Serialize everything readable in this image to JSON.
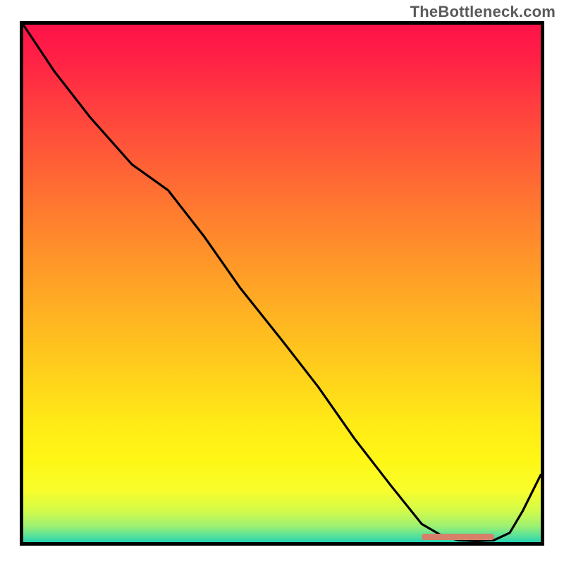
{
  "watermark": "TheBottleneck.com",
  "chart_data": {
    "type": "line",
    "title": "",
    "xlabel": "",
    "ylabel": "",
    "x": [
      0.0,
      0.06,
      0.13,
      0.21,
      0.28,
      0.35,
      0.42,
      0.5,
      0.57,
      0.64,
      0.71,
      0.77,
      0.81,
      0.84,
      0.875,
      0.91,
      0.94,
      0.965,
      1.0
    ],
    "values": [
      1.0,
      0.91,
      0.82,
      0.73,
      0.68,
      0.59,
      0.49,
      0.39,
      0.3,
      0.2,
      0.11,
      0.035,
      0.012,
      0.004,
      0.002,
      0.004,
      0.018,
      0.06,
      0.13
    ],
    "xlim": [
      0,
      1
    ],
    "ylim": [
      0,
      1
    ],
    "optimal_range_x": [
      0.77,
      0.91
    ],
    "notes": "Normalized axes (no tick labels visible). Curve descends steeply with a slight knee near x≈0.21, reaches a flat minimum near y≈0 over x≈0.77–0.91 (marked by a salmon band), then rises to ≈0.13 at x=1."
  }
}
